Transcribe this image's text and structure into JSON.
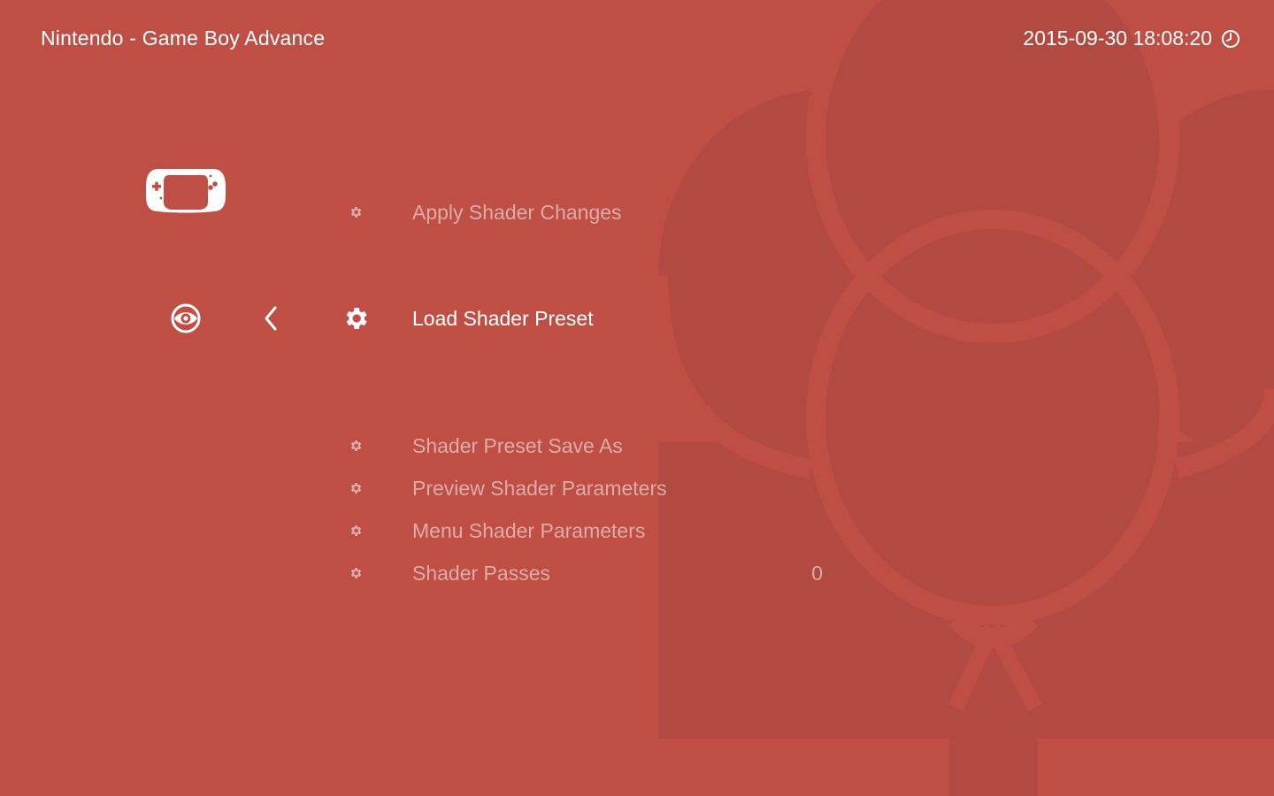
{
  "header": {
    "title": "Nintendo - Game Boy Advance",
    "datetime": "2015-09-30 18:08:20"
  },
  "icons": {
    "system": "game-boy-advance-icon",
    "tab": "eye-icon",
    "back": "chevron-left-icon",
    "clock": "clock-icon",
    "setting": "gear-icon"
  },
  "menu": {
    "items": [
      {
        "label": "Apply Shader Changes",
        "value": ""
      },
      {
        "label": "Load Shader Preset",
        "value": "",
        "selected": true
      },
      {
        "label": "Shader Preset Save As",
        "value": ""
      },
      {
        "label": "Preview Shader Parameters",
        "value": ""
      },
      {
        "label": "Menu Shader Parameters",
        "value": ""
      },
      {
        "label": "Shader Passes",
        "value": "0"
      }
    ]
  },
  "theme": {
    "background": "#bf4f45",
    "art": "#b24a42",
    "text": "#ffffff"
  }
}
